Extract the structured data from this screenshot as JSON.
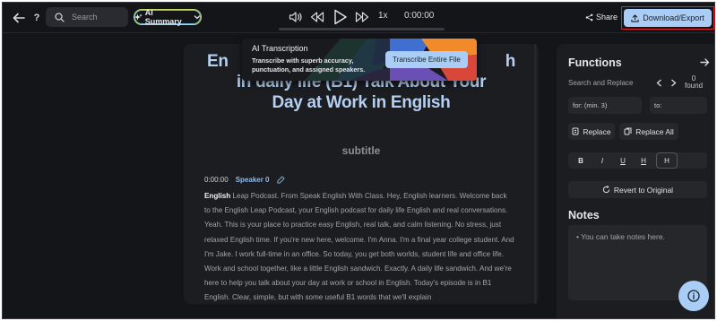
{
  "topbar": {
    "search_placeholder": "Search",
    "ai_summary_label": "AI Summary",
    "speed": "1x",
    "time": "0:00:00",
    "share_label": "Share",
    "download_label": "Download/Export"
  },
  "popup": {
    "title": "AI Transcription",
    "description": "Transcribe with superb accuracy, punctuation, and assigned speakers.",
    "button_label": "Transcribe Entire File"
  },
  "editor": {
    "title": "En... in Daily life (B1) Talk About Your Day at Work in English",
    "title_line1": "En",
    "title_line1_tail": "h",
    "title_line2": "in daily life (B1) Talk About Your",
    "title_line3": "Day at Work in English",
    "subtitle": "subtitle",
    "timestamp": "0:00:00",
    "speaker": "Speaker 0",
    "first_word": "English",
    "transcript": " Leap Podcast. From Speak English With Class. Hey, English learners. Welcome back to the English Leap Podcast, your English podcast for daily life English and real conversations. Yeah. This is your place to practice easy English, real talk, and calm listening. No stress, just relaxed English time. If you're new here, welcome. I'm Anna. I'm a final year college student. And I'm Jake. I work full-time in an office. So today, you get both worlds, student life and office life. Work and school together, like a little English sandwich. Exactly. A daily life sandwich. And we're here to help you talk about your day at work or school in English. Today's episode is in B1 English. Clear, simple, but with some useful B1 words that we'll explain"
  },
  "panel": {
    "functions_title": "Functions",
    "search_replace_label": "Search and Replace",
    "found_count": "0",
    "found_label": "found",
    "for_value": "for: (min. 3)",
    "to_value": "to:",
    "replace_label": "Replace",
    "replace_all_label": "Replace All",
    "format_buttons": [
      "B",
      "I",
      "U",
      "H",
      "H"
    ],
    "revert_label": "Revert to Original",
    "notes_title": "Notes",
    "notes_placeholder": "• You can take notes here."
  },
  "colors": {
    "accent": "#a9cdf4",
    "title_blue": "#b4d0f2",
    "highlight_red": "#e0242d",
    "background": "#141519",
    "panel": "#1c1d21"
  }
}
